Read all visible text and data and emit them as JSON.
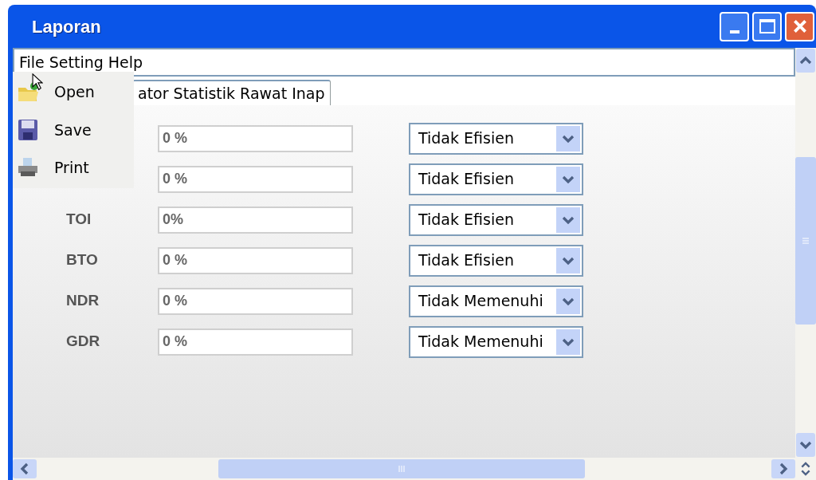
{
  "window": {
    "title": "Laporan"
  },
  "menu_bar": [
    "File",
    "Setting",
    "Help"
  ],
  "file_menu": [
    {
      "label": "Open",
      "kind": "open"
    },
    {
      "label": "Save",
      "kind": "save"
    },
    {
      "label": "Print",
      "kind": "print"
    }
  ],
  "tabs": [
    {
      "label": "ator Statistik Rawat Inap",
      "selected": true
    }
  ],
  "rows": [
    {
      "value": "0 %",
      "status": "Tidak Efisien"
    },
    {
      "value": "0 %",
      "status": "Tidak Efisien"
    },
    {
      "label": "TOI",
      "value": "0%",
      "status": "Tidak Efisien"
    },
    {
      "label": "BTO",
      "value": "0 %",
      "status": "Tidak Efisien"
    },
    {
      "label": "NDR",
      "value": "0 %",
      "status": "Tidak Memenuhi"
    },
    {
      "label": "GDR",
      "value": "0 %",
      "status": "Tidak Memenuhi"
    }
  ]
}
